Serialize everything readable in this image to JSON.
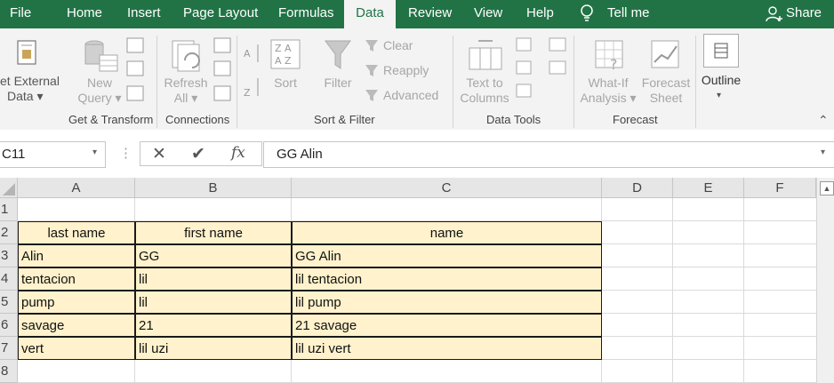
{
  "tabs": [
    "File",
    "Home",
    "Insert",
    "Page Layout",
    "Formulas",
    "Data",
    "Review",
    "View",
    "Help",
    "Tell me",
    "Share"
  ],
  "active_tab": "Data",
  "ribbon": {
    "get_external_data": [
      "et External",
      "Data ▾"
    ],
    "new_query": [
      "New",
      "Query ▾"
    ],
    "refresh_all": [
      "Refresh",
      "All ▾"
    ],
    "sort": "Sort",
    "filter": "Filter",
    "clear": "Clear",
    "reapply": "Reapply",
    "advanced": "Advanced",
    "text_to_columns": [
      "Text to",
      "Columns"
    ],
    "what_if": [
      "What-If",
      "Analysis ▾"
    ],
    "forecast_sheet": [
      "Forecast",
      "Sheet"
    ],
    "outline": "Outline",
    "groups": [
      "Get & Transform",
      "Connections",
      "Sort & Filter",
      "Data Tools",
      "Forecast"
    ]
  },
  "formula_bar": {
    "name_box": "C11",
    "formula": "GG Alin"
  },
  "columns": [
    "A",
    "B",
    "C",
    "D",
    "E",
    "F"
  ],
  "rows": [
    "1",
    "2",
    "3",
    "4",
    "5",
    "6",
    "7",
    "8"
  ],
  "table": {
    "headers": [
      "last name",
      "first name",
      "name"
    ],
    "rows": [
      [
        "Alin",
        "GG",
        "GG Alin"
      ],
      [
        "tentacion",
        "lil",
        "lil tentacion"
      ],
      [
        "pump",
        "lil",
        "lil pump"
      ],
      [
        "savage",
        "21",
        "21 savage"
      ],
      [
        "vert",
        "lil uzi",
        "lil uzi vert"
      ]
    ]
  },
  "colors": {
    "brand": "#217346",
    "table_fill": "#fff2cc"
  }
}
